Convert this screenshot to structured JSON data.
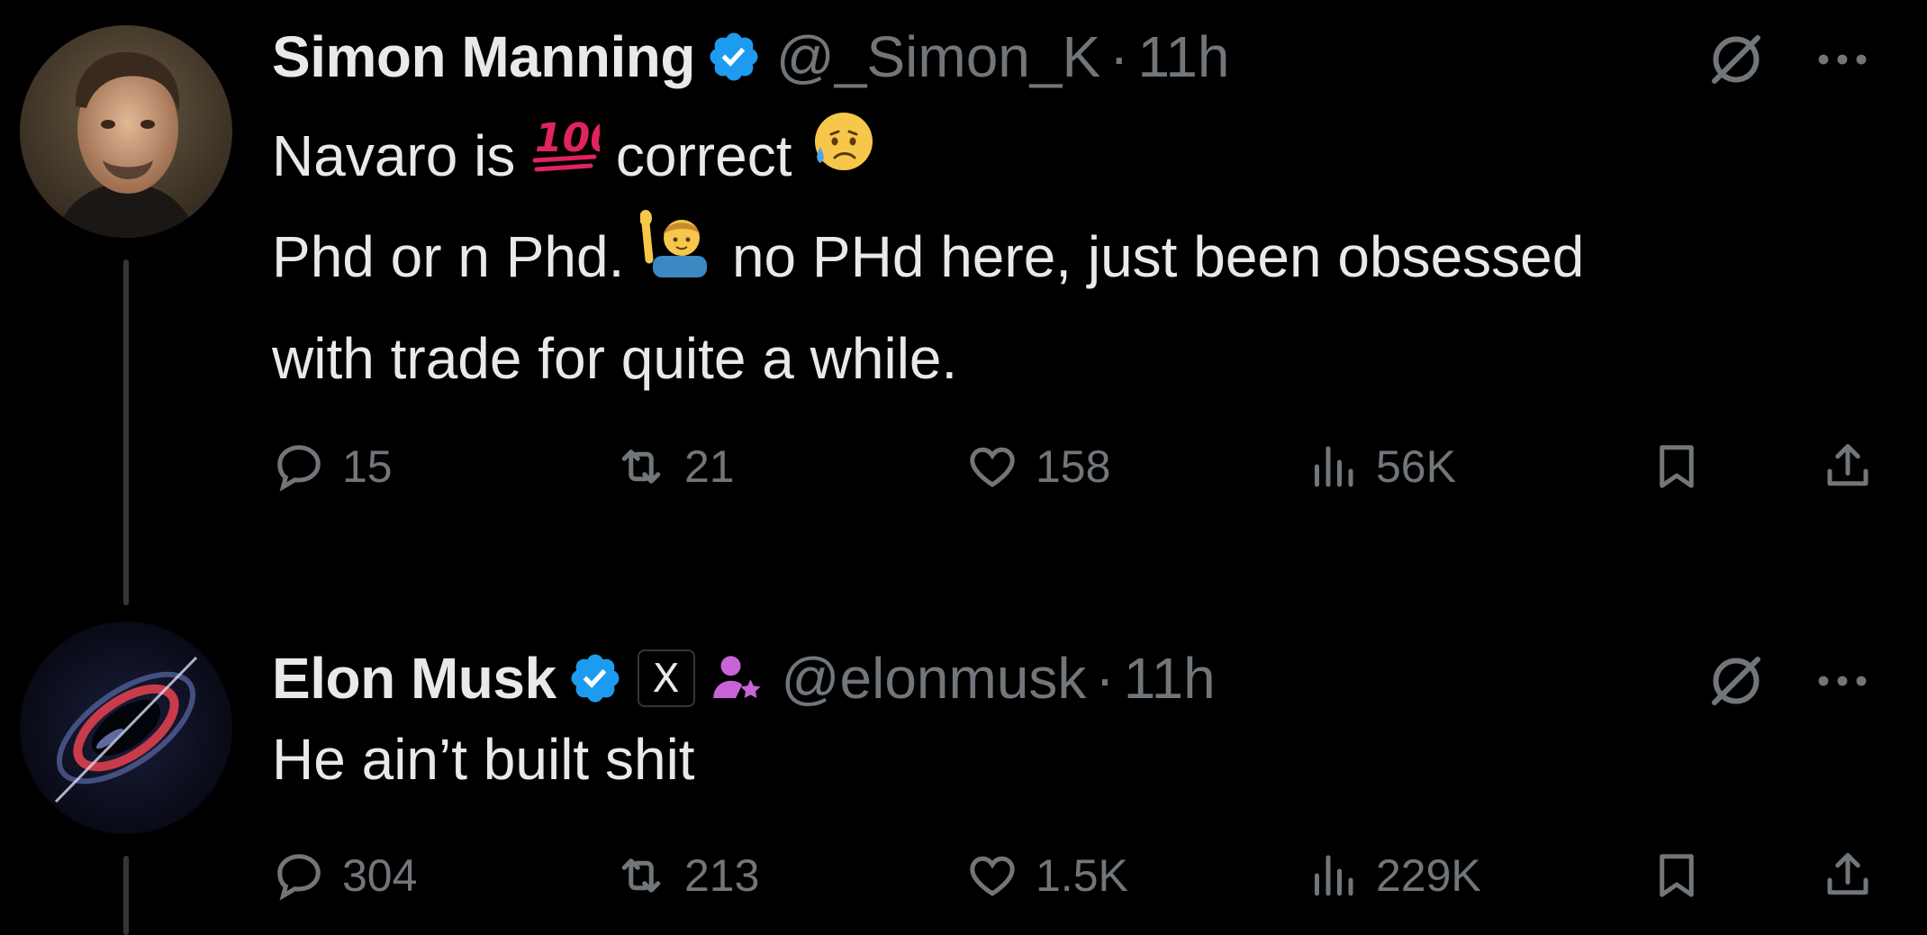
{
  "tweets": [
    {
      "display_name": "Simon Manning",
      "handle": "@_Simon_K",
      "separator": "·",
      "time": "11h",
      "line1_a": "Navaro is",
      "line1_b": "correct",
      "line2_a": "Phd or n Phd.",
      "line2_b": "no PHd here, just been obsessed",
      "line3": "with trade for quite a while.",
      "emojis": [
        "hundred-points-emoji",
        "sad-but-relieved-face-emoji",
        "man-raising-hand-emoji"
      ],
      "stats": {
        "replies": "15",
        "reposts": "21",
        "likes": "158",
        "views": "56K"
      }
    },
    {
      "display_name": "Elon Musk",
      "handle": "@elonmusk",
      "separator": "·",
      "time": "11h",
      "affiliate_badge": "X",
      "text": "He ain’t built shit",
      "stats": {
        "replies": "304",
        "reposts": "213",
        "likes": "1.5K",
        "views": "229K"
      }
    }
  ],
  "colors": {
    "background": "#000000",
    "text_primary": "#e7e9ea",
    "text_secondary": "#71767b",
    "verified": "#1d9bf0",
    "thread_line": "#333639"
  },
  "icons": [
    "verified-icon",
    "grok-icon",
    "more-icon",
    "reply-icon",
    "repost-icon",
    "like-icon",
    "views-icon",
    "bookmark-icon",
    "share-icon",
    "affiliate-x-icon",
    "person-star-icon"
  ]
}
